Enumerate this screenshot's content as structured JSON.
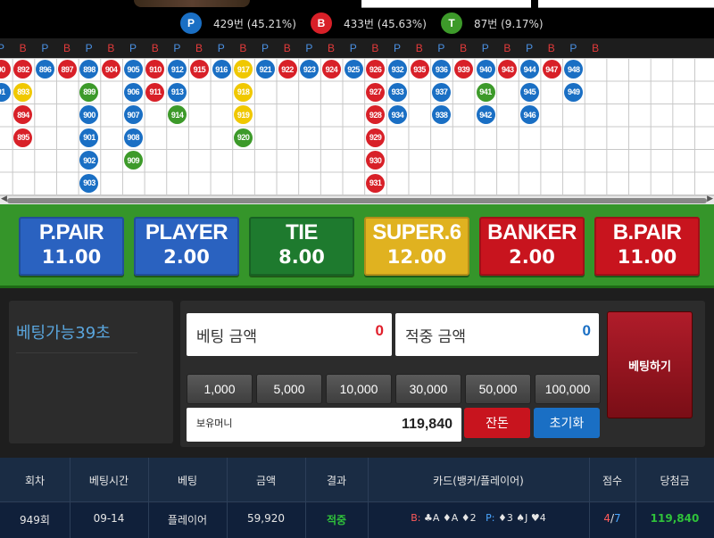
{
  "stats": {
    "player": {
      "icon": "P",
      "text": "429번 (45.21%)",
      "color": "#1a6fc4"
    },
    "banker": {
      "icon": "B",
      "text": "433번 (45.63%)",
      "color": "#d82028"
    },
    "tie": {
      "icon": "T",
      "text": "87번 (9.17%)",
      "color": "#3d9a2a"
    }
  },
  "road": {
    "header_letters": [
      "P",
      "B",
      "P",
      "B",
      "P",
      "B",
      "P",
      "B",
      "P",
      "B",
      "P",
      "B",
      "P",
      "B",
      "P",
      "B",
      "P",
      "B",
      "P",
      "B",
      "P",
      "B",
      "P",
      "B",
      "P",
      "B",
      "P",
      "B"
    ],
    "colors": {
      "P": "#1a6fc4",
      "B": "#d82028",
      "T": "#3d9a2a",
      "S": "#f0c800"
    },
    "columns": [
      {
        "cells": [
          {
            "n": "90",
            "c": "B"
          },
          {
            "n": "91",
            "c": "P"
          }
        ]
      },
      {
        "cells": [
          {
            "n": "892",
            "c": "B"
          },
          {
            "n": "893",
            "c": "S"
          },
          {
            "n": "894",
            "c": "B"
          },
          {
            "n": "895",
            "c": "B"
          }
        ]
      },
      {
        "cells": [
          {
            "n": "896",
            "c": "P"
          }
        ]
      },
      {
        "cells": [
          {
            "n": "897",
            "c": "B"
          }
        ]
      },
      {
        "cells": [
          {
            "n": "898",
            "c": "P"
          },
          {
            "n": "899",
            "c": "T"
          },
          {
            "n": "900",
            "c": "P"
          },
          {
            "n": "901",
            "c": "P"
          },
          {
            "n": "902",
            "c": "P"
          },
          {
            "n": "903",
            "c": "P"
          }
        ]
      },
      {
        "cells": [
          {
            "n": "904",
            "c": "B"
          }
        ]
      },
      {
        "cells": [
          {
            "n": "905",
            "c": "P"
          },
          {
            "n": "906",
            "c": "P"
          },
          {
            "n": "907",
            "c": "P"
          },
          {
            "n": "908",
            "c": "P"
          },
          {
            "n": "909",
            "c": "T"
          }
        ]
      },
      {
        "cells": [
          {
            "n": "910",
            "c": "B"
          },
          {
            "n": "911",
            "c": "B"
          }
        ]
      },
      {
        "cells": [
          {
            "n": "912",
            "c": "P"
          },
          {
            "n": "913",
            "c": "P"
          },
          {
            "n": "914",
            "c": "T"
          }
        ]
      },
      {
        "cells": [
          {
            "n": "915",
            "c": "B"
          }
        ]
      },
      {
        "cells": [
          {
            "n": "916",
            "c": "P"
          }
        ]
      },
      {
        "cells": [
          {
            "n": "917",
            "c": "S"
          },
          {
            "n": "918",
            "c": "S"
          },
          {
            "n": "919",
            "c": "S"
          },
          {
            "n": "920",
            "c": "T"
          }
        ]
      },
      {
        "cells": [
          {
            "n": "921",
            "c": "P"
          }
        ]
      },
      {
        "cells": [
          {
            "n": "922",
            "c": "B"
          }
        ]
      },
      {
        "cells": [
          {
            "n": "923",
            "c": "P"
          }
        ]
      },
      {
        "cells": [
          {
            "n": "924",
            "c": "B"
          }
        ]
      },
      {
        "cells": [
          {
            "n": "925",
            "c": "P"
          }
        ]
      },
      {
        "cells": [
          {
            "n": "926",
            "c": "B"
          },
          {
            "n": "927",
            "c": "B"
          },
          {
            "n": "928",
            "c": "B"
          },
          {
            "n": "929",
            "c": "B"
          },
          {
            "n": "930",
            "c": "B"
          },
          {
            "n": "931",
            "c": "B"
          }
        ]
      },
      {
        "cells": [
          {
            "n": "932",
            "c": "P"
          },
          {
            "n": "933",
            "c": "P"
          },
          {
            "n": "934",
            "c": "P"
          }
        ]
      },
      {
        "cells": [
          {
            "n": "935",
            "c": "B"
          }
        ]
      },
      {
        "cells": [
          {
            "n": "936",
            "c": "P"
          },
          {
            "n": "937",
            "c": "P"
          },
          {
            "n": "938",
            "c": "P"
          }
        ]
      },
      {
        "cells": [
          {
            "n": "939",
            "c": "B"
          }
        ]
      },
      {
        "cells": [
          {
            "n": "940",
            "c": "P"
          },
          {
            "n": "941",
            "c": "T"
          },
          {
            "n": "942",
            "c": "P"
          }
        ]
      },
      {
        "cells": [
          {
            "n": "943",
            "c": "B"
          }
        ]
      },
      {
        "cells": [
          {
            "n": "944",
            "c": "P"
          },
          {
            "n": "945",
            "c": "P"
          },
          {
            "n": "946",
            "c": "P"
          }
        ]
      },
      {
        "cells": [
          {
            "n": "947",
            "c": "B"
          }
        ]
      },
      {
        "cells": [
          {
            "n": "948",
            "c": "P"
          },
          {
            "n": "949",
            "c": "P"
          }
        ]
      }
    ]
  },
  "bets": [
    {
      "name": "P.PAIR",
      "odds": "11.00",
      "bg": "#2a62c0"
    },
    {
      "name": "PLAYER",
      "odds": "2.00",
      "bg": "#2a62c0"
    },
    {
      "name": "TIE",
      "odds": "8.00",
      "bg": "#1e7a2e"
    },
    {
      "name": "SUPER.6",
      "odds": "12.00",
      "bg": "#e0b220"
    },
    {
      "name": "BANKER",
      "odds": "2.00",
      "bg": "#c8141e"
    },
    {
      "name": "B.PAIR",
      "odds": "11.00",
      "bg": "#c8141e"
    }
  ],
  "panel": {
    "timer": "베팅가능39초",
    "bet_amount_label": "베팅 금액",
    "bet_amount_value": "0",
    "win_amount_label": "적중 금액",
    "win_amount_value": "0",
    "chips": [
      "1,000",
      "5,000",
      "10,000",
      "30,000",
      "50,000",
      "100,000"
    ],
    "balance_label": "보유머니",
    "balance_value": "119,840",
    "change_btn": "잔돈",
    "reset_btn": "초기화",
    "place_btn": "베팅하기"
  },
  "table": {
    "headers": [
      "회차",
      "베팅시간",
      "베팅",
      "금액",
      "결과",
      "카드(뱅커/플레이어)",
      "점수",
      "당첨금"
    ],
    "row": {
      "round": "949회",
      "time": "09-14",
      "bet": "플레이어",
      "amount": "59,920",
      "result": "적중",
      "cards_b_label": "B:",
      "cards_b": "♣A ♦A ♦2",
      "cards_p_label": "P:",
      "cards_p": "♦3 ♠J ♥4",
      "score_b": "4",
      "score_sep": "/",
      "score_p": "7",
      "payout": "119,840"
    }
  }
}
